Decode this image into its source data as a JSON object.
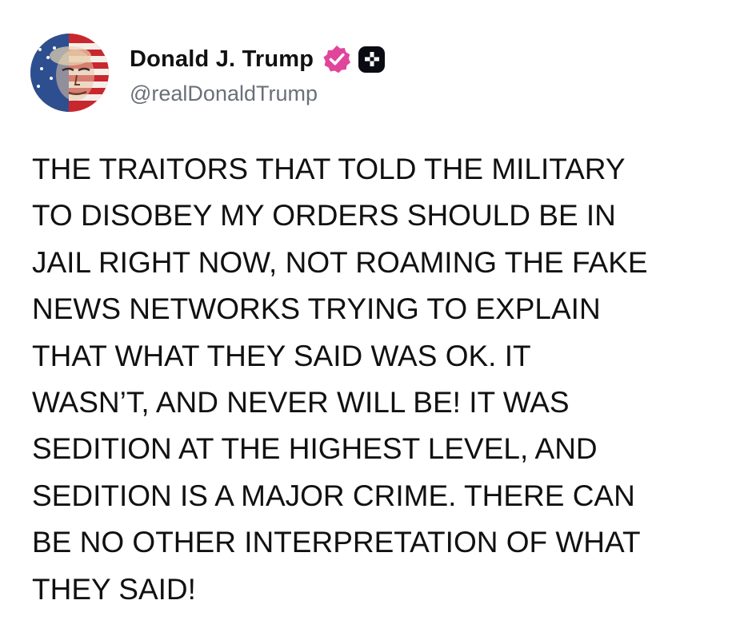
{
  "post": {
    "author": {
      "display_name": "Donald J. Trump",
      "handle": "@realDonaldTrump",
      "avatar_icon": "flag-portrait-avatar",
      "verified_badge_icon": "verified-badge-icon",
      "verified_badge_color": "#e0459b",
      "plus_badge_icon": "plus-badge-icon"
    },
    "body": "THE TRAITORS THAT TOLD THE MILITARY\nTO DISOBEY MY ORDERS SHOULD BE IN\nJAIL RIGHT NOW, NOT ROAMING THE FAKE\nNEWS NETWORKS TRYING TO EXPLAIN\nTHAT WHAT THEY SAID WAS OK. IT\nWASN’T, AND NEVER WILL BE! IT WAS\nSEDITION AT THE HIGHEST LEVEL, AND\nSEDITION IS A MAJOR CRIME. THERE CAN\nBE NO OTHER INTERPRETATION OF WHAT\nTHEY SAID!"
  },
  "colors": {
    "background": "#ffffff",
    "text": "#111111",
    "handle": "#6b6f78",
    "badge_pink": "#e0459b",
    "badge_dark": "#0b0b14"
  }
}
